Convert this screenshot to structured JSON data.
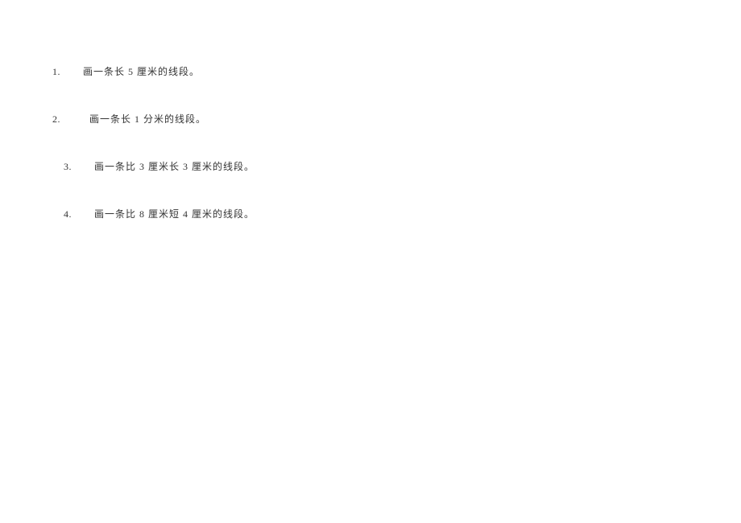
{
  "questions": [
    {
      "num": "1.",
      "text": "画一条长 5 厘米的线段。"
    },
    {
      "num": "2.",
      "text": "画一条长 1 分米的线段。"
    },
    {
      "num": "3.",
      "text": "画一条比 3 厘米长 3 厘米的线段。"
    },
    {
      "num": "4.",
      "text": "画一条比 8 厘米短 4 厘米的线段。"
    }
  ]
}
